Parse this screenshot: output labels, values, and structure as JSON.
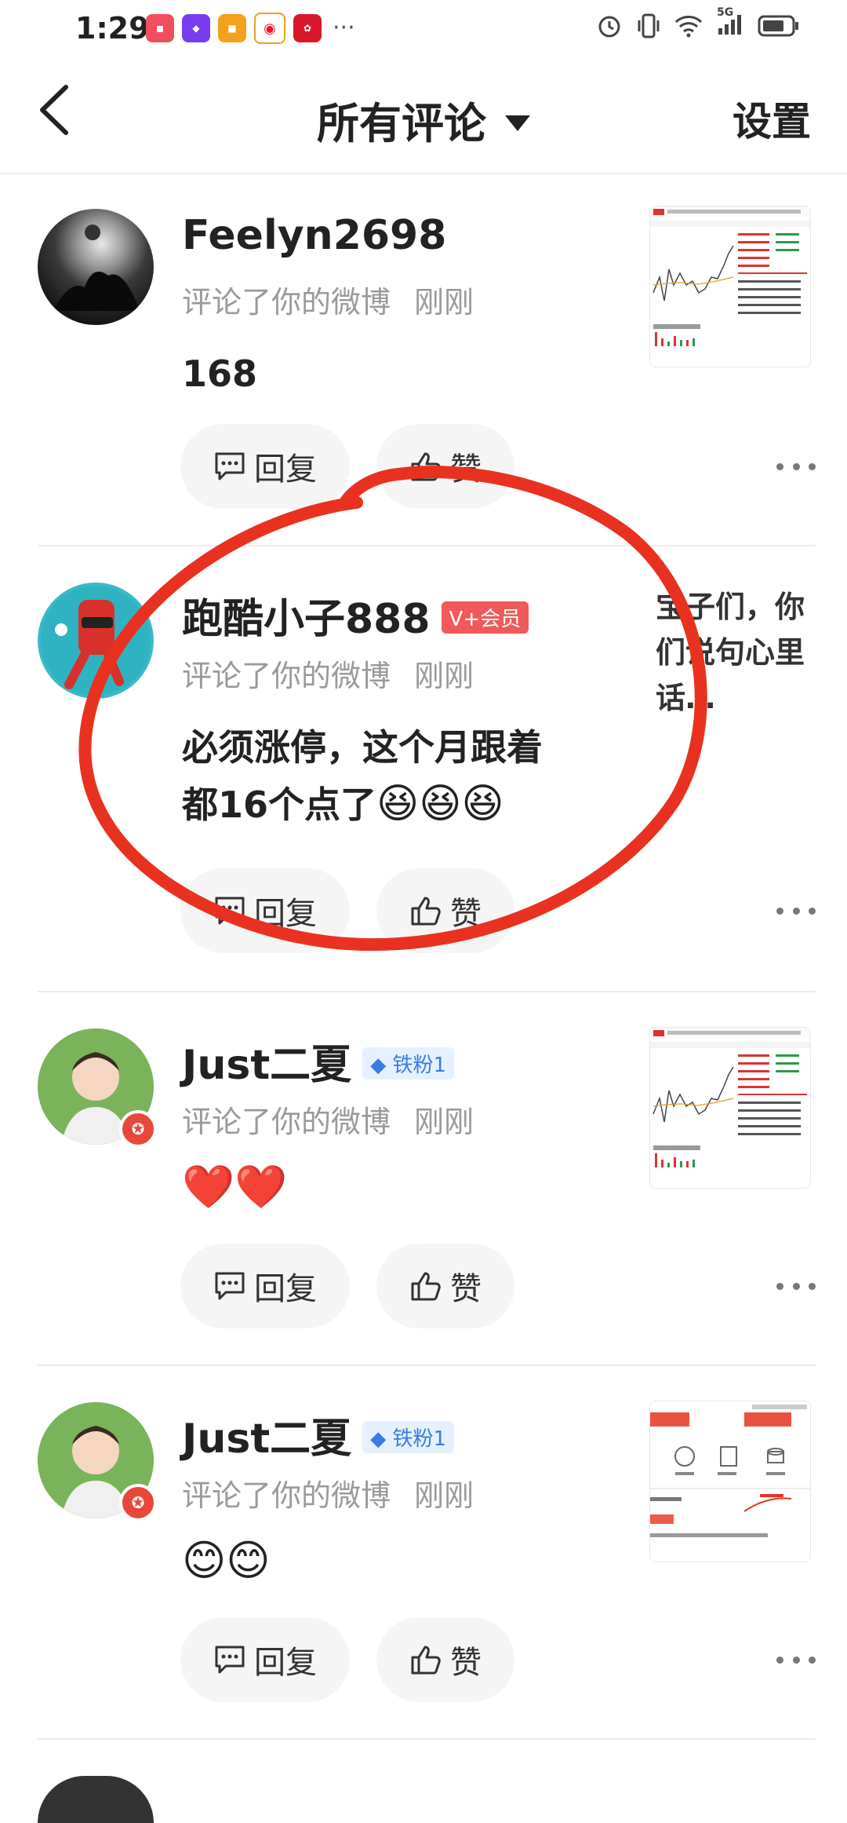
{
  "status_bar": {
    "time": "1:29",
    "network": "5G"
  },
  "nav": {
    "title": "所有评论",
    "settings": "设置"
  },
  "comments": [
    {
      "username": "Feelyn2698",
      "tag": "",
      "action": "评论了你的微博",
      "time": "刚刚",
      "text_line1": "168",
      "text_line2": "",
      "reply_label": "回复",
      "like_label": "赞",
      "side_text": "",
      "has_thumb": true
    },
    {
      "username": "跑酷小子888",
      "tag": "V+会员",
      "action": "评论了你的微博",
      "time": "刚刚",
      "text_line1": "必须涨停，这个月跟着",
      "text_line2": "都16个点了",
      "reply_label": "回复",
      "like_label": "赞",
      "side_text": "宝子们，你们说句心里话…",
      "has_thumb": false
    },
    {
      "username": "Just二夏",
      "tag": "铁粉1",
      "action": "评论了你的微博",
      "time": "刚刚",
      "text_line1": "",
      "text_line2": "",
      "reply_label": "回复",
      "like_label": "赞",
      "side_text": "",
      "has_thumb": true
    },
    {
      "username": "Just二夏",
      "tag": "铁粉1",
      "action": "评论了你的微博",
      "time": "刚刚",
      "text_line1": "",
      "text_line2": "",
      "reply_label": "回复",
      "like_label": "赞",
      "side_text": "",
      "has_thumb": true
    }
  ],
  "colors": {
    "accent_red": "#e8321f",
    "vip_tag": "#f05a5a",
    "fan_tag": "#3a7de0",
    "meta_gray": "#9a9a9a"
  }
}
